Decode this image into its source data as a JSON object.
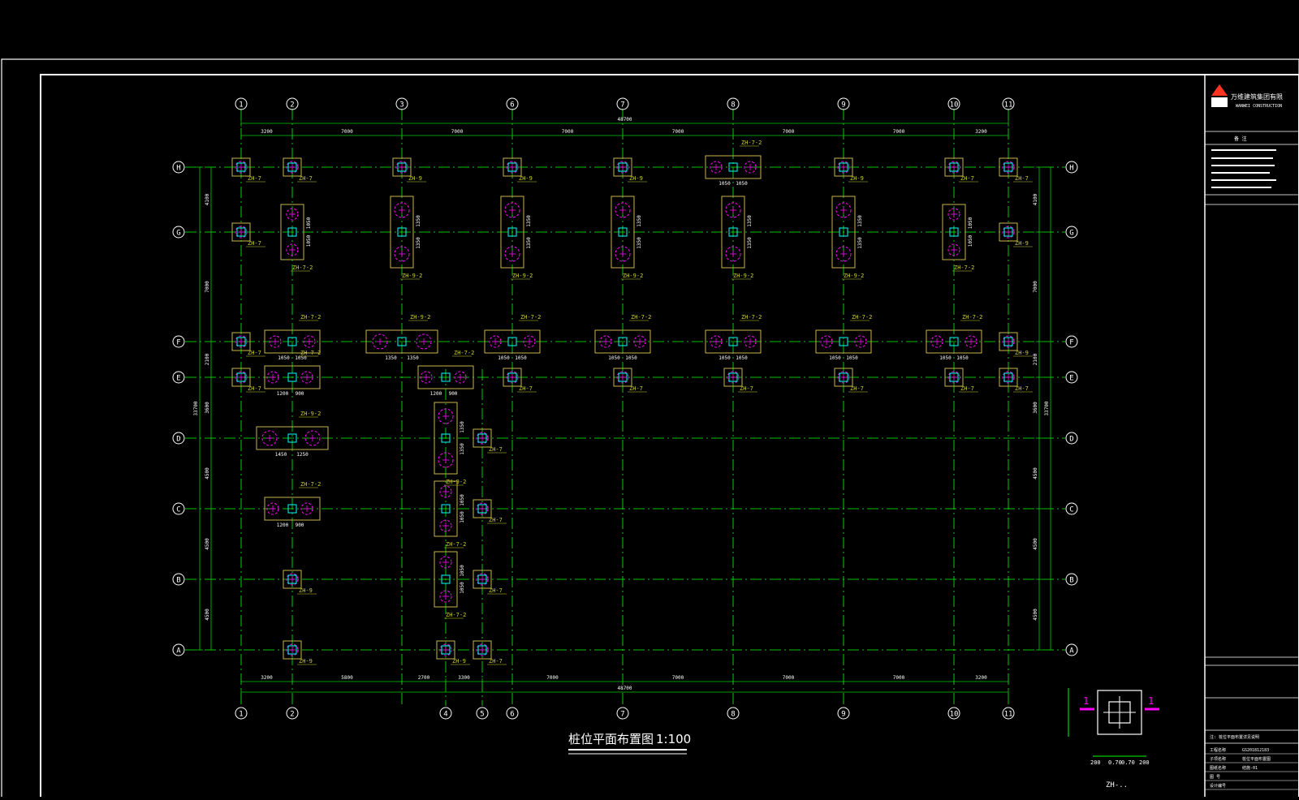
{
  "drawing": {
    "title": "桩位平面布置图",
    "scale": "1:100",
    "colors": {
      "background": "#000000",
      "frame": "#ffffff",
      "grid_axis": "#00ff00",
      "dimension": "#00cc00",
      "pile_cap": "#c8b44a",
      "column": "#00ffff",
      "pile": "#ff00ff",
      "label": "#cccc33"
    }
  },
  "grid": {
    "columns": [
      "1",
      "2",
      "3",
      "6",
      "7",
      "8",
      "9",
      "10",
      "11"
    ],
    "bottom_columns": [
      "1",
      "2",
      "4",
      "5",
      "6",
      "7",
      "8",
      "9",
      "10",
      "11"
    ],
    "rows": [
      "H",
      "G",
      "F",
      "E",
      "D",
      "C",
      "B",
      "A"
    ]
  },
  "dimensions": {
    "top_total": "48700",
    "top_spans": [
      "3200",
      "7000",
      "7000",
      "7000",
      "7000",
      "7000",
      "7000",
      "3200"
    ],
    "bottom_total": "48700",
    "bottom_spans": [
      "3200",
      "5800",
      "2700",
      "3300",
      "7000",
      "7000",
      "7000",
      "7000",
      "3200"
    ],
    "left_total": "33700",
    "left_spans": [
      "4100",
      "7000",
      "2100",
      "3600",
      "4500",
      "4500",
      "4500"
    ],
    "right_total": "33700",
    "right_spans": [
      "4100",
      "7000",
      "2100",
      "3600",
      "4500",
      "4500",
      "4500"
    ]
  },
  "pile_labels": {
    "zh7": "ZH-7",
    "zh9": "ZH-9",
    "zh72": "ZH-7-2",
    "zh92": "ZH-9-2",
    "cap_dims_a": "1050",
    "cap_dims_b": "1200",
    "cap_dims_c": "900",
    "cap_dims_d": "1350",
    "cap_dims_e": "1450",
    "cap_dims_f": "1250",
    "cap_dims_g": "150",
    "cap_dims_h": "200"
  },
  "detail": {
    "section_mark": "1",
    "name": "ZH-..",
    "dims_bottom": [
      "200",
      "0.70",
      "0.70",
      "200"
    ],
    "dims_side": [
      "200",
      "0.70",
      "0.70",
      "200"
    ]
  },
  "title_block": {
    "company": "万维建筑集团有限",
    "company_en": "WANWEI CONSTRUCTION",
    "section": "备 注",
    "note_heading": "注: 桩位平面布置详见说明",
    "rows": [
      "工程名称",
      "子项名称",
      "图纸名称",
      "图 号",
      "设计编号"
    ],
    "values": [
      "GS201812183",
      "桩位平面布置图",
      "结施-01",
      "",
      ""
    ]
  }
}
